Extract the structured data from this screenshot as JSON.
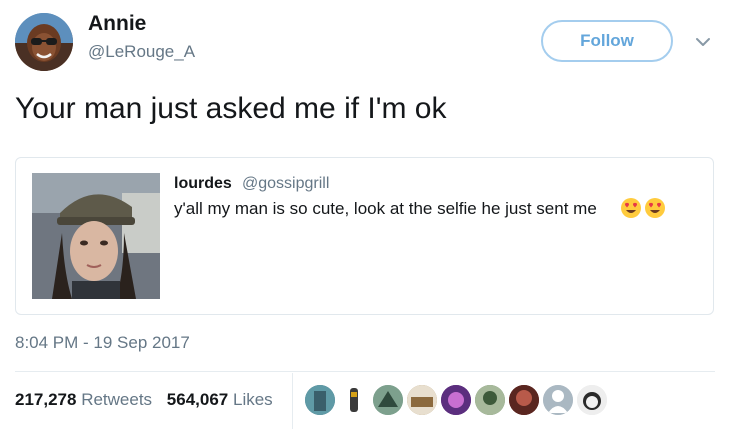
{
  "author": {
    "name": "Annie",
    "handle": "@LeRouge_A",
    "avatar_icon": "profile-photo"
  },
  "follow_button": {
    "label": "Follow"
  },
  "menu_icon": "chevron-down-icon",
  "tweet_text": "Your man just asked me if I'm ok",
  "quoted_tweet": {
    "name": "lourdes",
    "handle": "@gossipgrill",
    "text": "y'all my man is so cute, look at the selfie he just sent me",
    "emojis": [
      "heart-eyes-emoji",
      "heart-eyes-emoji"
    ],
    "image": "selfie-photo"
  },
  "timestamp": "8:04 PM - 19 Sep 2017",
  "stats": {
    "retweets_count": "217,278",
    "retweets_label": "Retweets",
    "likes_count": "564,067",
    "likes_label": "Likes"
  },
  "liker_avatars": [
    "avatar-1",
    "avatar-2",
    "avatar-3",
    "avatar-4",
    "avatar-5",
    "avatar-6",
    "avatar-7",
    "avatar-8",
    "avatar-9"
  ],
  "colors": {
    "text": "#14171a",
    "secondary": "#657786",
    "follow_border": "#a4cdee",
    "follow_text": "#63a6db",
    "border": "#e1e8ed"
  }
}
